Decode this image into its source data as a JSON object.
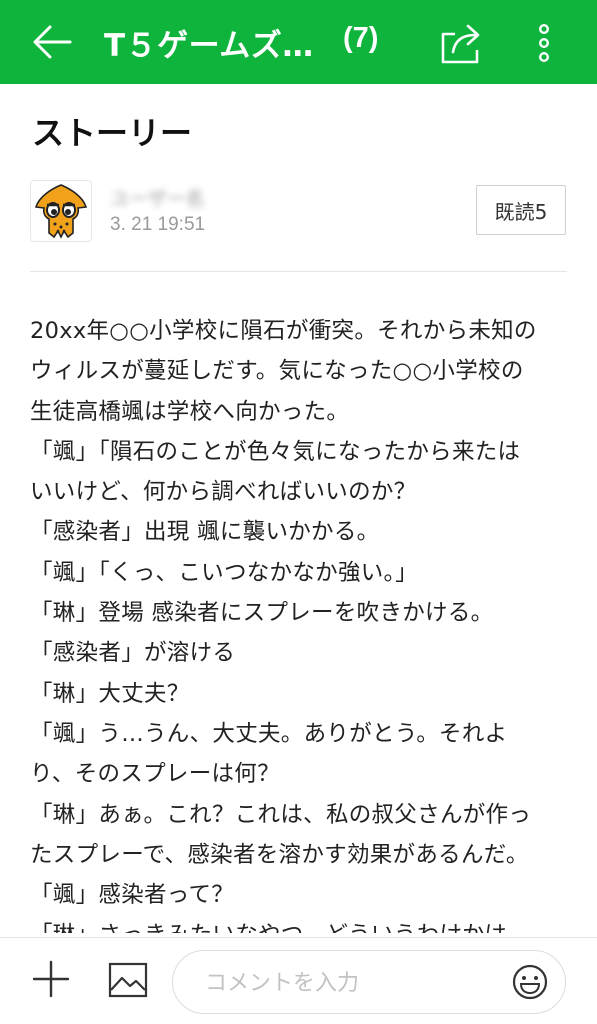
{
  "header": {
    "back_icon": "arrow-left-icon",
    "title": "T５ゲームズ…",
    "count": "(7)",
    "share_icon": "share-icon",
    "more_icon": "more-vertical-icon"
  },
  "post": {
    "title": "ストーリー",
    "author_avatar": "squid-avatar",
    "author_name": "ユーザー名",
    "date": "3. 21 19:51",
    "read_label": "既読5",
    "lines": [
      "20xx年○○小学校に隕石が衝突。それから未知の",
      "ウィルスが蔓延しだす。気になった○○小学校の",
      "生徒高橋颯は学校へ向かった。",
      "「颯」「隕石のことが色々気になったから来たは",
      "いいけど、何から調べればいいのか？",
      "「感染者」出現 颯に襲いかかる。",
      "「颯」「くっ、こいつなかなか強い。」",
      "「琳」登場 感染者にスプレーを吹きかける。",
      "「感染者」が溶ける",
      "「琳」大丈夫？",
      "「颯」う…うん、大丈夫。ありがとう。それよ",
      "り、そのスプレーは何？",
      "「琳」あぁ。これ？これは、私の叔父さんが作っ",
      "たスプレーで、感染者を溶かす効果があるんだ。",
      "「颯」感染者って？",
      "「琳」さっきみたいなやつ。どういうわけかは、"
    ]
  },
  "bottom": {
    "plus_icon": "plus-icon",
    "image_icon": "image-icon",
    "comment_placeholder": "コメントを入力",
    "emoji_icon": "smiley-icon"
  },
  "colors": {
    "header_bg": "#0fb43c",
    "text": "#222222",
    "muted": "#9a9a9a"
  }
}
